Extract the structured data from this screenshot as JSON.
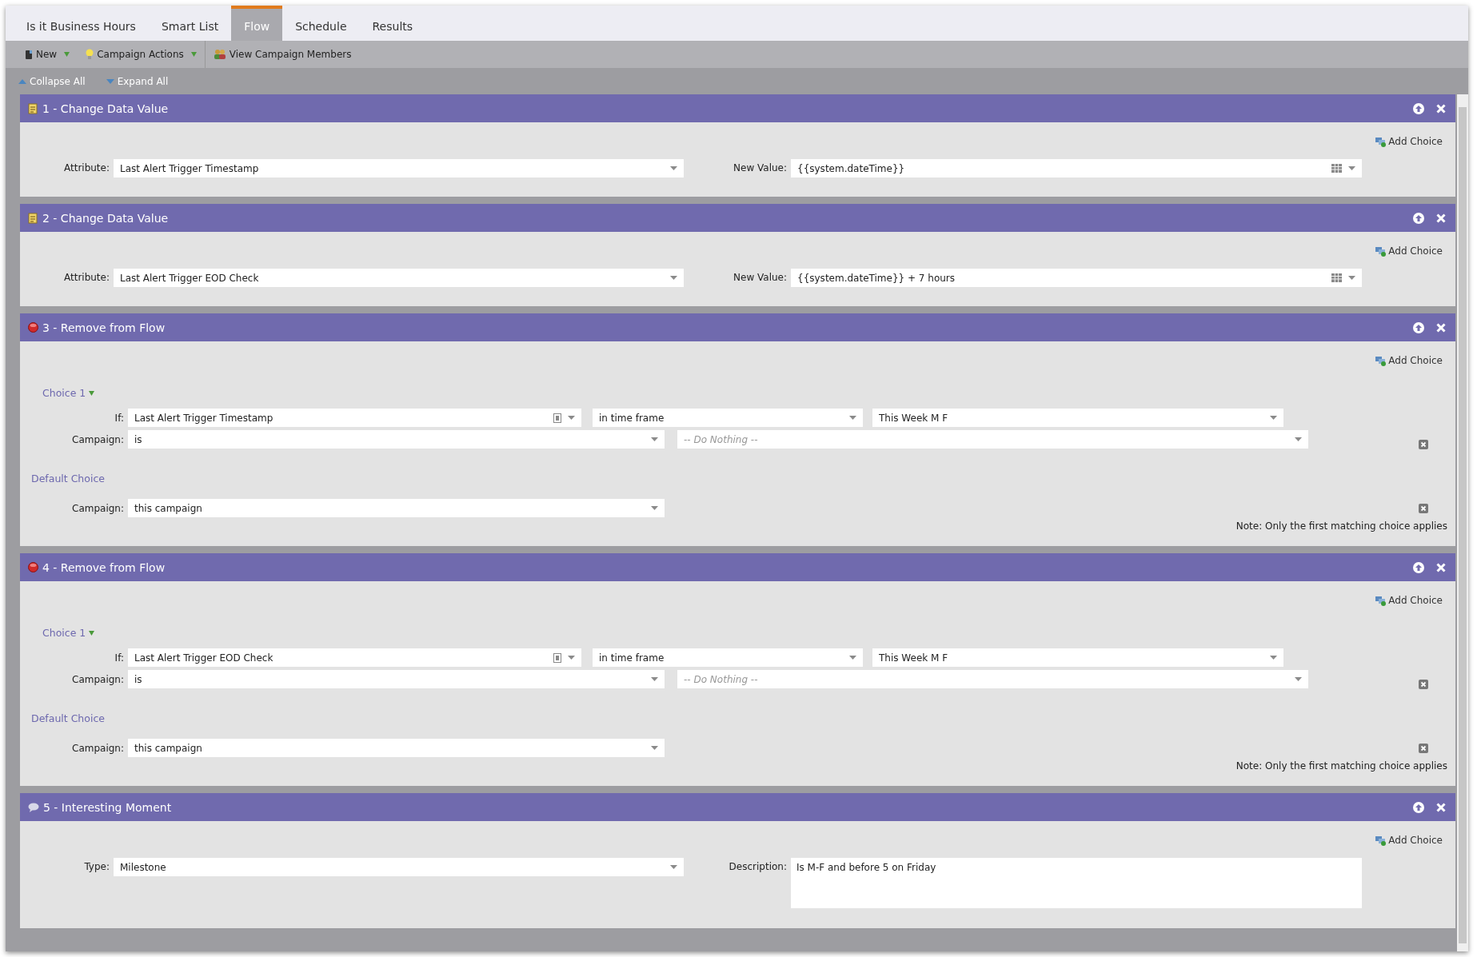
{
  "tabs": [
    {
      "label": "Is it Business Hours",
      "selected": false
    },
    {
      "label": "Smart List",
      "selected": false
    },
    {
      "label": "Flow",
      "selected": true
    },
    {
      "label": "Schedule",
      "selected": false
    },
    {
      "label": "Results",
      "selected": false
    }
  ],
  "toolbar": [
    {
      "kind": "new",
      "label": "New",
      "dropdown": true
    },
    {
      "kind": "actions",
      "label": "Campaign Actions",
      "dropdown": true
    },
    {
      "kind": "members",
      "label": "View Campaign Members",
      "dropdown": false
    }
  ],
  "tree_controls": [
    {
      "kind": "collapse",
      "label": "Collapse All"
    },
    {
      "kind": "expand",
      "label": "Expand All"
    }
  ],
  "steps": [
    {
      "kind": "change_data",
      "title": "1 - Change Data Value",
      "add_choice": "Add Choice",
      "fields": [
        {
          "label": "Attribute:",
          "value": "Last Alert Trigger Timestamp"
        },
        {
          "label": "New Value:",
          "value": "{{system.dateTime}}"
        }
      ]
    },
    {
      "kind": "change_data",
      "title": "2 - Change Data Value",
      "add_choice": "Add Choice",
      "fields": [
        {
          "label": "Attribute:",
          "value": "Last Alert Trigger EOD Check"
        },
        {
          "label": "New Value:",
          "value": "{{system.dateTime}} + 7 hours"
        }
      ]
    },
    {
      "kind": "remove_from_flow",
      "title": "3 - Remove from Flow",
      "add_choice": "Add Choice",
      "choice": {
        "label": "Choice 1",
        "if_label": "If:",
        "if_field": "Last Alert Trigger Timestamp",
        "operator": "in time frame",
        "value": "This Week M F",
        "campaign_label": "Campaign:",
        "campaign_op": "is",
        "campaign_placeholder": "-- Do Nothing --"
      },
      "default": {
        "label": "Default Choice",
        "campaign_label": "Campaign:",
        "campaign_value": "this campaign"
      },
      "note": "Note: Only the first matching choice applies"
    },
    {
      "kind": "remove_from_flow",
      "title": "4 - Remove from Flow",
      "add_choice": "Add Choice",
      "choice": {
        "label": "Choice 1",
        "if_label": "If:",
        "if_field": "Last Alert Trigger EOD Check",
        "operator": "in time frame",
        "value": "This Week M F",
        "campaign_label": "Campaign:",
        "campaign_op": "is",
        "campaign_placeholder": "-- Do Nothing --"
      },
      "default": {
        "label": "Default Choice",
        "campaign_label": "Campaign:",
        "campaign_value": "this campaign"
      },
      "note": "Note: Only the first matching choice applies"
    },
    {
      "kind": "interesting_moment",
      "title": "5 - Interesting Moment",
      "add_choice": "Add Choice",
      "fields": [
        {
          "label": "Type:",
          "value": "Milestone"
        },
        {
          "label": "Description:",
          "value": "Is M-F and before 5 on Friday"
        }
      ]
    }
  ]
}
